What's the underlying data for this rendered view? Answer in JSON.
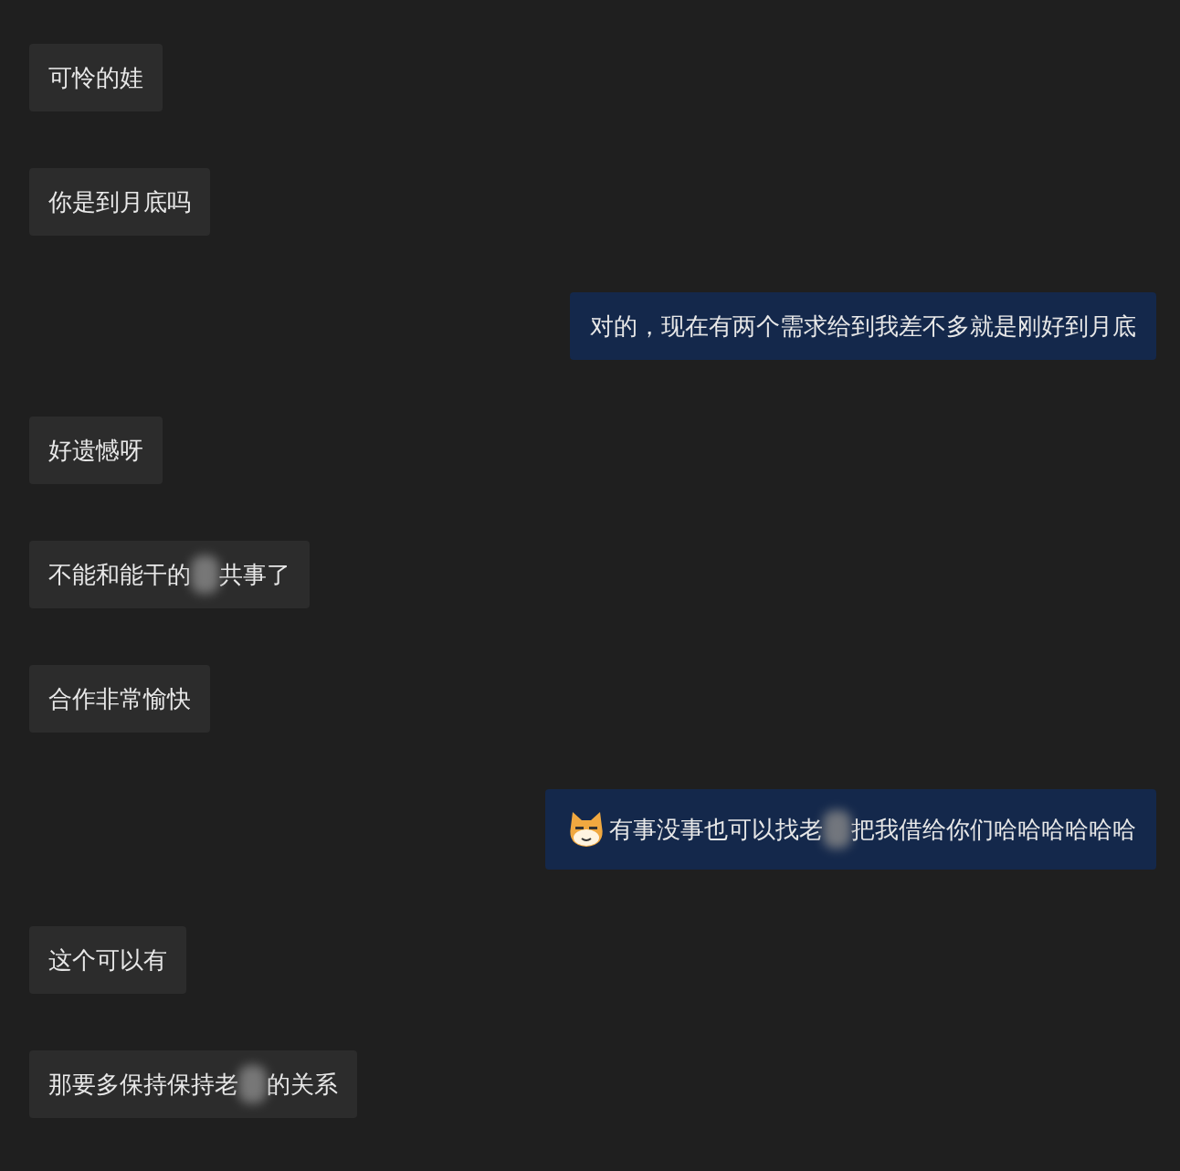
{
  "messages": [
    {
      "kind": "received",
      "segments": [
        "可怜的娃"
      ]
    },
    {
      "kind": "received",
      "segments": [
        "你是到月底吗"
      ]
    },
    {
      "kind": "sent",
      "segments": [
        "对的，现在有两个需求给到我差不多就是刚好到月底"
      ]
    },
    {
      "kind": "received",
      "segments": [
        "好遗憾呀"
      ]
    },
    {
      "kind": "received",
      "segments": [
        "不能和能干的",
        "共事了"
      ]
    },
    {
      "kind": "received",
      "segments": [
        "合作非常愉快"
      ]
    },
    {
      "kind": "sent_sticker",
      "segments": [
        "有事没事也可以找老",
        "把我借给你们哈哈哈哈哈哈"
      ]
    },
    {
      "kind": "received",
      "segments": [
        "这个可以有"
      ]
    },
    {
      "kind": "received",
      "segments": [
        "那要多保持保持老",
        "的关系"
      ]
    }
  ]
}
